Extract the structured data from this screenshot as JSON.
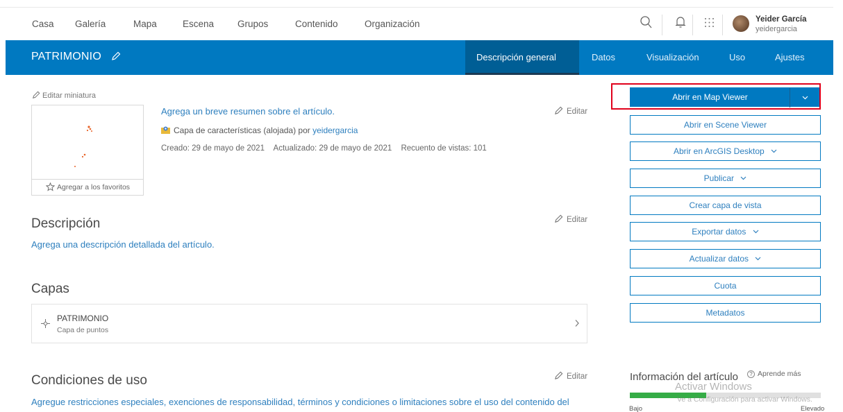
{
  "topnav": {
    "items": [
      "Casa",
      "Galería",
      "Mapa",
      "Escena",
      "Grupos",
      "Contenido",
      "Organización"
    ],
    "icons": [
      "search-icon",
      "bell-icon",
      "apps-grid-icon"
    ],
    "user": {
      "name": "Yeider García",
      "login": "yeidergarcia"
    }
  },
  "header": {
    "title": "PATRIMONIO",
    "tabs": [
      "Descripción general",
      "Datos",
      "Visualización",
      "Uso",
      "Ajustes"
    ],
    "active_tab": "Descripción general",
    "color": "#0079c1"
  },
  "thumbnail": {
    "edit_label": "Editar miniatura",
    "favorite_label": "Agregar a los favoritos"
  },
  "summary": {
    "placeholder_link": "Agrega un breve resumen sobre el artículo.",
    "type_text": "Capa de características (alojada) por",
    "owner": "yeidergarcia",
    "created": "Creado: 29 de mayo de 2021",
    "updated": "Actualizado: 29 de mayo de 2021",
    "views": "Recuento de vistas: 101",
    "edit_label": "Editar"
  },
  "description": {
    "heading": "Descripción",
    "placeholder_link": "Agrega una descripción detallada del artículo.",
    "edit_label": "Editar"
  },
  "layers": {
    "heading": "Capas",
    "items": [
      {
        "name": "PATRIMONIO",
        "type": "Capa de puntos"
      }
    ]
  },
  "terms": {
    "heading": "Condiciones de uso",
    "placeholder_link": "Agregue restricciones especiales, exenciones de responsabilidad, términos y condiciones o limitaciones sobre el uso del contenido del",
    "edit_label": "Editar"
  },
  "actions": {
    "primary": "Abrir en Map Viewer",
    "scene_viewer": "Abrir en Scene Viewer",
    "arcgis_desktop": "Abrir en ArcGIS Desktop",
    "publish": "Publicar",
    "create_view": "Crear capa de vista",
    "export": "Exportar datos",
    "update": "Actualizar datos",
    "quota": "Cuota",
    "metadata": "Metadatos"
  },
  "item_info": {
    "heading": "Información del artículo",
    "learn_more": "Aprende más",
    "progress_fraction": 0.4,
    "low_label": "Bajo",
    "high_label": "Elevado",
    "bar_color": "#35ac46"
  },
  "windows_watermark": {
    "title": "Activar Windows",
    "subtitle": "Ve a Configuración para activar Windows."
  }
}
